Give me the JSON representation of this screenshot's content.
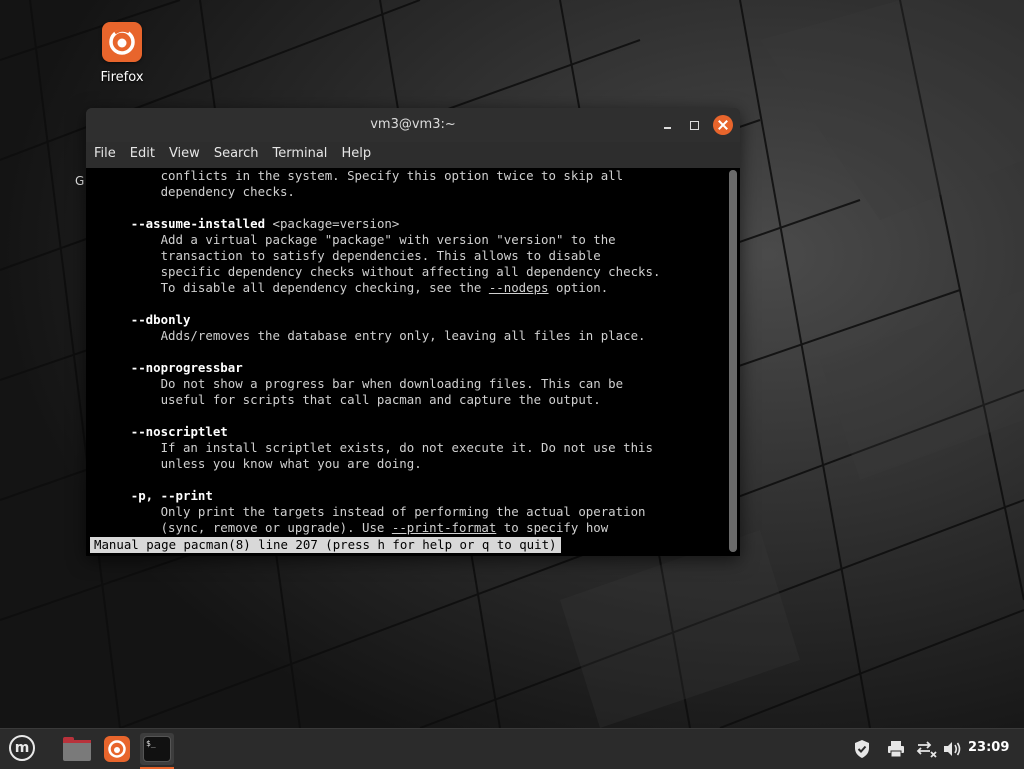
{
  "desktop": {
    "icons": [
      {
        "label": "Firefox"
      }
    ],
    "partial_label": "G"
  },
  "window": {
    "title": "vm3@vm3:~",
    "menu": [
      "File",
      "Edit",
      "View",
      "Search",
      "Terminal",
      "Help"
    ]
  },
  "terminal": {
    "lines": [
      [
        {
          "t": "          conflicts in the system. Specify this option twice to skip all"
        }
      ],
      [
        {
          "t": "          dependency checks."
        }
      ],
      [
        {
          "t": ""
        }
      ],
      [
        {
          "t": "      "
        },
        {
          "t": "--assume-installed",
          "s": "b"
        },
        {
          "t": " <package=version>"
        }
      ],
      [
        {
          "t": "          Add a virtual package \"package\" with version \"version\" to the"
        }
      ],
      [
        {
          "t": "          transaction to satisfy dependencies. This allows to disable"
        }
      ],
      [
        {
          "t": "          specific dependency checks without affecting all dependency checks."
        }
      ],
      [
        {
          "t": "          To disable all dependency checking, see the "
        },
        {
          "t": "--nodeps",
          "s": "u"
        },
        {
          "t": " option."
        }
      ],
      [
        {
          "t": ""
        }
      ],
      [
        {
          "t": "      "
        },
        {
          "t": "--dbonly",
          "s": "b"
        }
      ],
      [
        {
          "t": "          Adds/removes the database entry only, leaving all files in place."
        }
      ],
      [
        {
          "t": ""
        }
      ],
      [
        {
          "t": "      "
        },
        {
          "t": "--noprogressbar",
          "s": "b"
        }
      ],
      [
        {
          "t": "          Do not show a progress bar when downloading files. This can be"
        }
      ],
      [
        {
          "t": "          useful for scripts that call pacman and capture the output."
        }
      ],
      [
        {
          "t": ""
        }
      ],
      [
        {
          "t": "      "
        },
        {
          "t": "--noscriptlet",
          "s": "b"
        }
      ],
      [
        {
          "t": "          If an install scriptlet exists, do not execute it. Do not use this"
        }
      ],
      [
        {
          "t": "          unless you know what you are doing."
        }
      ],
      [
        {
          "t": ""
        }
      ],
      [
        {
          "t": "      "
        },
        {
          "t": "-p, --print",
          "s": "b"
        }
      ],
      [
        {
          "t": "          Only print the targets instead of performing the actual operation"
        }
      ],
      [
        {
          "t": "          (sync, remove or upgrade). Use "
        },
        {
          "t": "--print-format",
          "s": "u"
        },
        {
          "t": " to specify how"
        }
      ]
    ],
    "status": "Manual page pacman(8) line 207 (press h for help or q to quit)"
  },
  "taskbar": {
    "apps": [
      "menu-button",
      "files",
      "firefox",
      "terminal"
    ],
    "tray_icons": [
      "shield-icon",
      "printer-icon",
      "network-disconnected-icon",
      "volume-icon"
    ],
    "clock": "23:09",
    "mint_glyph": "m",
    "term_glyph": "$_"
  },
  "colors": {
    "accent": "#e8652c",
    "terminal_bg": "#000000",
    "taskbar_bg": "#2b2b2b"
  }
}
